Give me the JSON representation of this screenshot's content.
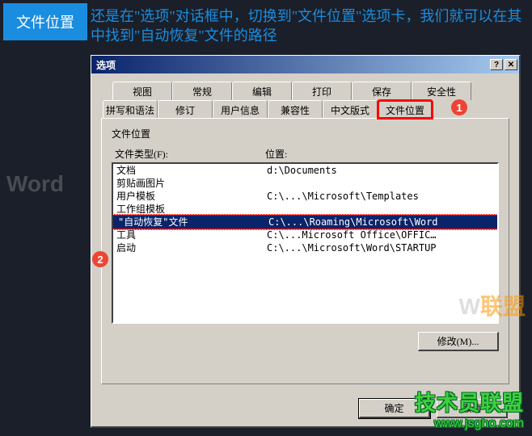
{
  "header": {
    "badge": "文件位置",
    "text": "还是在\"选项\"对话框中，切换到\"文件位置\"选项卡，我们就可以在其中找到\"自动恢复\"文件的路径"
  },
  "dialog": {
    "title": "选项",
    "help_btn": "?",
    "close_btn": "✕"
  },
  "tabs": {
    "row1": [
      "视图",
      "常规",
      "编辑",
      "打印",
      "保存",
      "安全性"
    ],
    "row2": [
      "拼写和语法",
      "修订",
      "用户信息",
      "兼容性",
      "中文版式",
      "文件位置"
    ]
  },
  "panel": {
    "section_title": "文件位置",
    "col_type": "文件类型(F):",
    "col_loc": "位置:",
    "rows": [
      {
        "type": "文档",
        "loc": "d:\\Documents"
      },
      {
        "type": "剪贴画图片",
        "loc": ""
      },
      {
        "type": "用户模板",
        "loc": "C:\\...\\Microsoft\\Templates"
      },
      {
        "type": "工作组模板",
        "loc": ""
      },
      {
        "type": "\"自动恢复\"文件",
        "loc": "C:\\...\\Roaming\\Microsoft\\Word"
      },
      {
        "type": "工具",
        "loc": "C:\\...Microsoft Office\\OFFIC…"
      },
      {
        "type": "启动",
        "loc": "C:\\...\\Microsoft\\Word\\STARTUP"
      }
    ],
    "modify_btn": "修改(M)..."
  },
  "footer": {
    "ok": "确定",
    "cancel": "取消"
  },
  "badges": {
    "b1": "1",
    "b2": "2"
  },
  "watermark": {
    "w1": "Word",
    "w2_a": "W",
    "w2_b": "联盟"
  },
  "credit": {
    "line1": "技术员联盟",
    "line2": "www.jsgho.com"
  }
}
